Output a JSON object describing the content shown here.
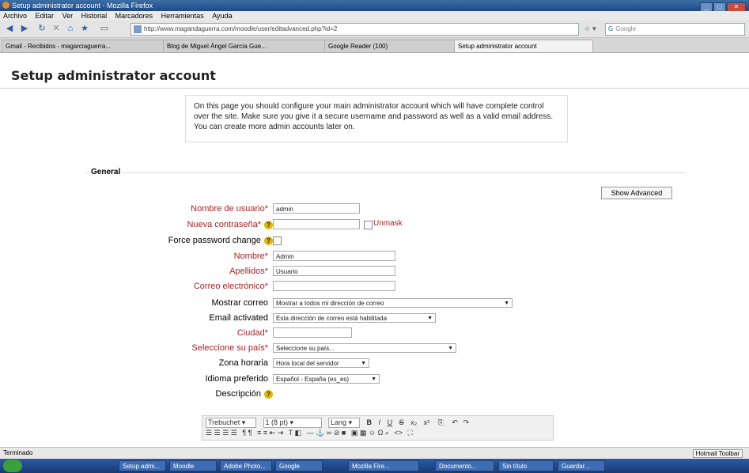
{
  "window": {
    "title": "Setup administrator account - Mozilla Firefox"
  },
  "menu": [
    "Archivo",
    "Editar",
    "Ver",
    "Historial",
    "Marcadores",
    "Herramientas",
    "Ayuda"
  ],
  "nav": {
    "url": "http://www.magandaguerra.com/moodle/user/editadvanced.php?id=2",
    "search_placeholder": "Google"
  },
  "tabs": [
    {
      "label": "Gmail - Recibidos - magarciaguerra..."
    },
    {
      "label": "Blog de Miguel Ángel García Gue..."
    },
    {
      "label": "Google Reader (100)"
    },
    {
      "label": "Setup administrator account"
    }
  ],
  "page": {
    "title": "Setup administrator account",
    "info": "On this page you should configure your main administrator account which will have complete control over the site. Make sure you give it a secure username and password as well as a valid email address. You can create more admin accounts later on.",
    "section": "General",
    "show_advanced": "Show Advanced"
  },
  "form": {
    "username": {
      "label": "Nombre de usuario*",
      "value": "admin"
    },
    "password": {
      "label": "Nueva contraseña*",
      "value": "",
      "unmask": "Unmask"
    },
    "force_change": {
      "label": "Force password change"
    },
    "firstname": {
      "label": "Nombre*",
      "value": "Admin"
    },
    "lastname": {
      "label": "Apellidos*",
      "value": "Usuario"
    },
    "email": {
      "label": "Correo electrónico*",
      "value": ""
    },
    "maildisplay": {
      "label": "Mostrar correo",
      "value": "Mostrar a todos mi dirección de correo"
    },
    "emailactive": {
      "label": "Email activated",
      "value": "Esta dirección de correo está habilitada"
    },
    "city": {
      "label": "Ciudad*",
      "value": ""
    },
    "country": {
      "label": "Seleccione su país*",
      "value": "Seleccione su país..."
    },
    "timezone": {
      "label": "Zona horaria",
      "value": "Hora local del servidor"
    },
    "language": {
      "label": "Idioma preferido",
      "value": "Español - España (es_es)"
    },
    "description": {
      "label": "Descripción"
    }
  },
  "editor": {
    "font": "Trebuchet",
    "size": "1 (8 pt)",
    "lang": "Lang"
  },
  "status": {
    "text": "Terminado",
    "right": "Hotmail Toolbar"
  },
  "taskbar": [
    "Setup admi...",
    "Moodle",
    "Adobe Photo...",
    "Google",
    "Mozilla Fire...",
    "Documento...",
    "Sin título",
    "Guardar..."
  ],
  "colors": {
    "required": "#aa2222",
    "titlebar": "#1e4a86",
    "help": "#e0b800"
  }
}
